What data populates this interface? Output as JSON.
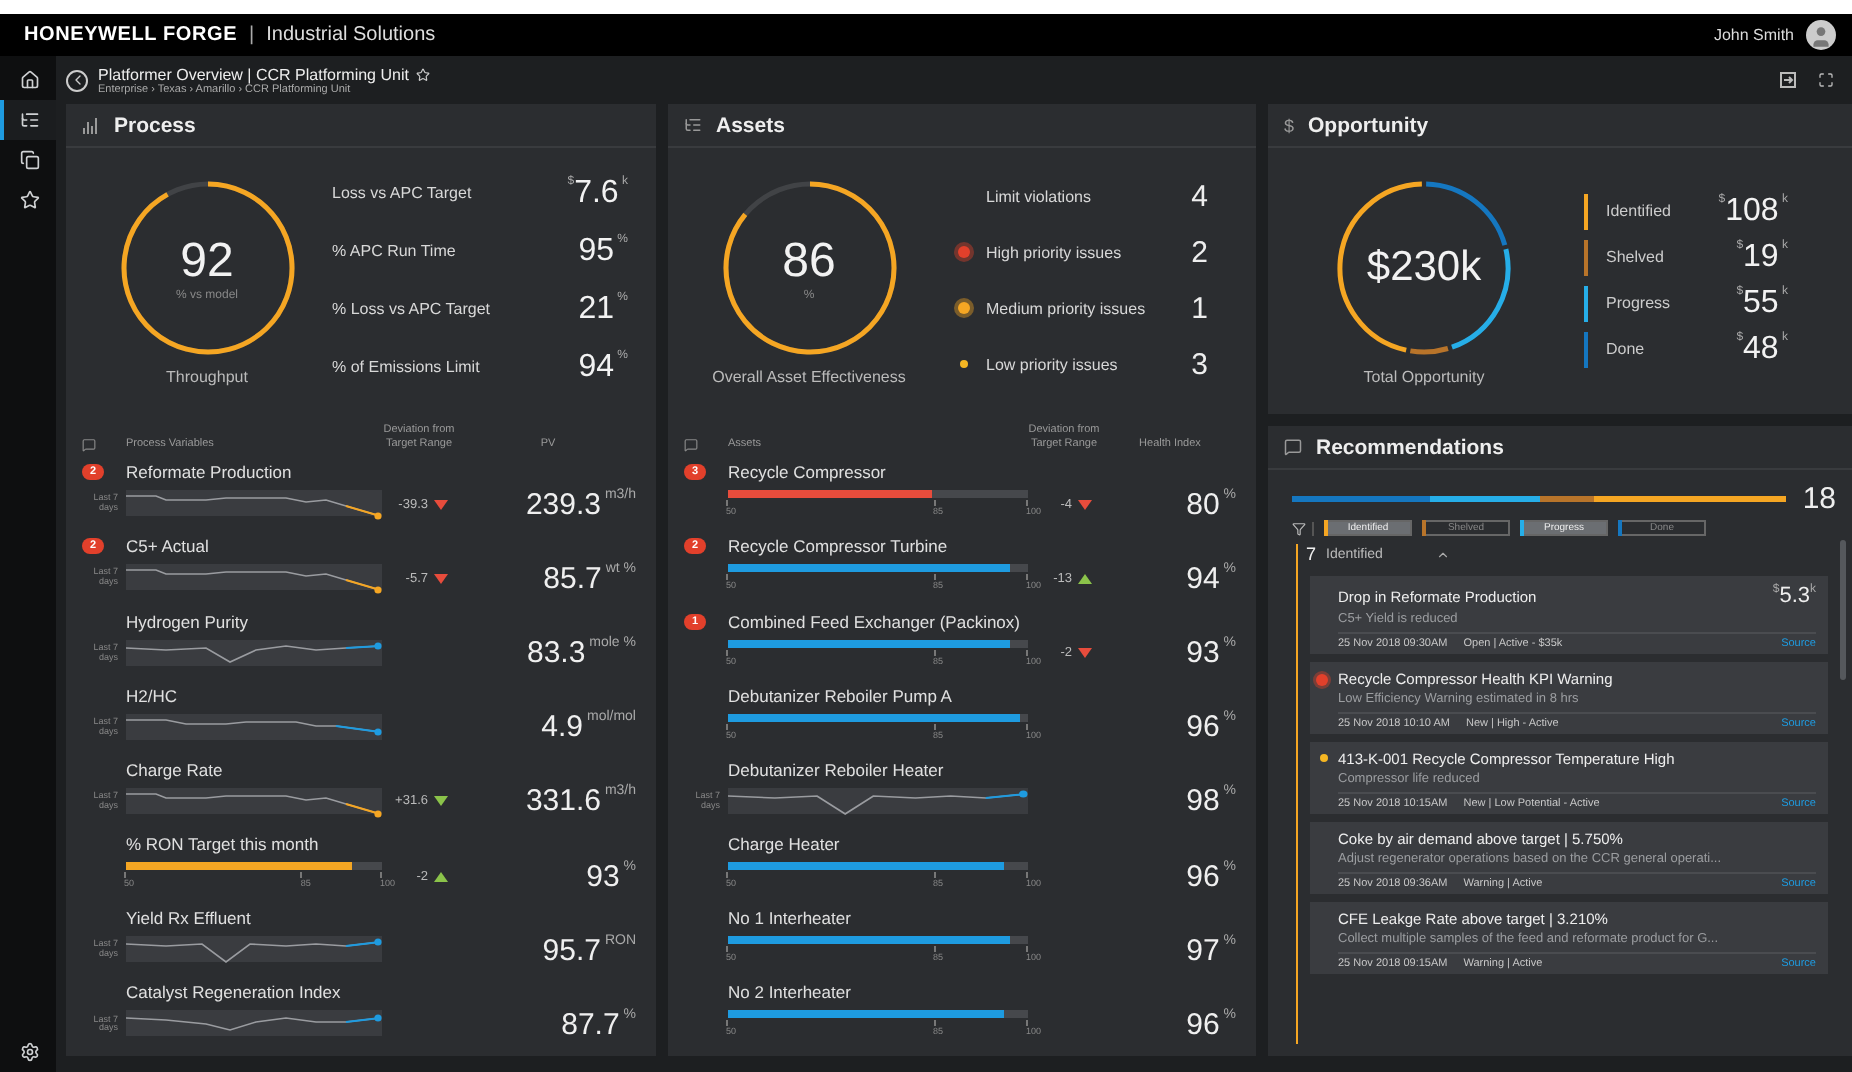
{
  "header": {
    "brand": "HONEYWELL FORGE",
    "separator": "|",
    "product": "Industrial Solutions",
    "user": "John Smith"
  },
  "sidebar": {
    "items": [
      {
        "selected": false
      },
      {
        "selected": true
      },
      {
        "selected": false
      },
      {
        "selected": false
      }
    ]
  },
  "breadcrumb": {
    "title": "Platformer Overview | CCR Platforming Unit",
    "path": "Enterprise › Texas › Amarillo › CCR Platforming Unit"
  },
  "process": {
    "title": "Process",
    "gauge": {
      "value": "92",
      "unit": "% vs model",
      "label": "Throughput"
    },
    "kpis": [
      {
        "label": "Loss vs APC Target",
        "prefix": "$",
        "value": "7.6",
        "suffix": "k"
      },
      {
        "label": "% APC Run Time",
        "value": "95",
        "suffix": "%"
      },
      {
        "label": "% Loss vs APC Target",
        "value": "21",
        "suffix": "%"
      },
      {
        "label": "% of Emissions Limit",
        "value": "94",
        "suffix": "%"
      }
    ],
    "columns": [
      "Process Variables",
      "Deviation from Target Range",
      "PV"
    ],
    "rows": [
      {
        "badge": "2",
        "name": "Reformate Production",
        "kind": "trend",
        "trend_label": "Last 7 days",
        "color": "#f5a623",
        "deviation": {
          "text": "-39.3",
          "up": false,
          "color": "#e74c3c"
        },
        "value": "239.3",
        "unit": "m3/h"
      },
      {
        "badge": "2",
        "name": "C5+ Actual",
        "kind": "trend",
        "trend_label": "Last 7 days",
        "color": "#f5a623",
        "deviation": {
          "text": "-5.7",
          "up": false,
          "color": "#e74c3c"
        },
        "value": "85.7",
        "unit": "wt %"
      },
      {
        "name": "Hydrogen Purity",
        "kind": "trend",
        "trend_label": "Last 7 days",
        "color": "#1e9be0",
        "value": "83.3",
        "unit": "mole %"
      },
      {
        "name": "H2/HC",
        "kind": "trend",
        "trend_label": "Last 7 days",
        "color": "#1e9be0",
        "value": "4.9",
        "unit": "mol/mol"
      },
      {
        "name": "Charge Rate",
        "kind": "trend",
        "trend_label": "Last 7 days",
        "color": "#f5a623",
        "deviation": {
          "text": "+31.6",
          "up": false,
          "color": "#8bc34a"
        },
        "value": "331.6",
        "unit": "m3/h"
      },
      {
        "name": "% RON Target this month",
        "kind": "bar",
        "level": 0.88,
        "color": "#f5a623",
        "scale": [
          "50",
          "85",
          "100"
        ],
        "deviation": {
          "text": "-2",
          "up": true,
          "color": "#8bc34a"
        },
        "value": "93",
        "unit": "%"
      },
      {
        "name": "Yield Rx Effluent",
        "kind": "trend",
        "trend_label": "Last 7 days",
        "color": "#1e9be0",
        "value": "95.7",
        "unit": "RON"
      },
      {
        "name": "Catalyst Regeneration Index",
        "kind": "trend",
        "trend_label": "Last 7 days",
        "color": "#1e9be0",
        "value": "87.7",
        "unit": "%"
      }
    ]
  },
  "assets": {
    "title": "Assets",
    "gauge": {
      "value": "86",
      "unit": "%",
      "label": "Overall Asset Effectiveness"
    },
    "issues": [
      {
        "label": "Limit violations",
        "count": "4",
        "kind": "plain"
      },
      {
        "label": "High priority issues",
        "count": "2",
        "kind": "high"
      },
      {
        "label": "Medium priority issues",
        "count": "1",
        "kind": "medium"
      },
      {
        "label": "Low priority issues",
        "count": "3",
        "kind": "low"
      }
    ],
    "columns": [
      "Assets",
      "Deviation from Target Range",
      "Health Index"
    ],
    "rows": [
      {
        "badge": "3",
        "name": "Recycle Compressor",
        "kind": "bar",
        "level": 0.68,
        "color": "#e74c3c",
        "scale": [
          "50",
          "85",
          "100"
        ],
        "deviation": {
          "text": "-4",
          "up": false,
          "color": "#e74c3c"
        },
        "value": "80",
        "unit": "%"
      },
      {
        "badge": "2",
        "name": "Recycle Compressor Turbine",
        "kind": "bar",
        "level": 0.94,
        "color": "#1e9be0",
        "scale": [
          "50",
          "85",
          "100"
        ],
        "deviation": {
          "text": "-13",
          "up": true,
          "color": "#8bc34a"
        },
        "value": "94",
        "unit": "%"
      },
      {
        "badge": "1",
        "name": "Combined Feed Exchanger (Packinox)",
        "kind": "bar",
        "level": 0.94,
        "color": "#1e9be0",
        "scale": [
          "50",
          "85",
          "100"
        ],
        "deviation": {
          "text": "-2",
          "up": false,
          "color": "#e74c3c"
        },
        "value": "93",
        "unit": "%"
      },
      {
        "name": "Debutanizer Reboiler Pump A",
        "kind": "bar",
        "level": 0.97,
        "color": "#1e9be0",
        "scale": [
          "50",
          "85",
          "100"
        ],
        "value": "96",
        "unit": "%"
      },
      {
        "name": "Debutanizer Reboiler Heater",
        "kind": "trend",
        "trend_label": "Last 7 days",
        "color": "#1e9be0",
        "value": "98",
        "unit": "%"
      },
      {
        "name": "Charge Heater",
        "kind": "bar",
        "level": 0.92,
        "color": "#1e9be0",
        "scale": [
          "50",
          "85",
          "100"
        ],
        "value": "96",
        "unit": "%"
      },
      {
        "name": "No 1 Interheater",
        "kind": "bar",
        "level": 0.94,
        "color": "#1e9be0",
        "scale": [
          "50",
          "85",
          "100"
        ],
        "value": "97",
        "unit": "%"
      },
      {
        "name": "No 2 Interheater",
        "kind": "bar",
        "level": 0.92,
        "color": "#1e9be0",
        "scale": [
          "50",
          "85",
          "100"
        ],
        "value": "96",
        "unit": "%"
      }
    ]
  },
  "opportunity": {
    "icon_text": "$",
    "title": "Opportunity",
    "gauge": {
      "value": "$230k",
      "label": "Total Opportunity"
    },
    "stats": [
      {
        "label": "Identified",
        "color": "#f5a623",
        "prefix": "$",
        "value": "108",
        "suffix": "k"
      },
      {
        "label": "Shelved",
        "color": "#b8742a",
        "prefix": "$",
        "value": "19",
        "suffix": "k"
      },
      {
        "label": "Progress",
        "color": "#26aee8",
        "prefix": "$",
        "value": "55",
        "suffix": "k"
      },
      {
        "label": "Done",
        "color": "#1577c0",
        "prefix": "$",
        "value": "48",
        "suffix": "k"
      }
    ]
  },
  "recommendations": {
    "title": "Recommendations",
    "count": "18",
    "bar": [
      {
        "color": "#1577c0"
      },
      {
        "color": "#26aee8"
      },
      {
        "color": "#b8742a"
      },
      {
        "color": "#f5a623"
      }
    ],
    "filters": [
      {
        "label": "Identified",
        "color": "#f5a623",
        "selected": true
      },
      {
        "label": "Shelved",
        "color": "#b8742a",
        "selected": false
      },
      {
        "label": "Progress",
        "color": "#26aee8",
        "selected": true
      },
      {
        "label": "Done",
        "color": "#1577c0",
        "selected": false
      }
    ],
    "group": {
      "count": "7",
      "label": "Identified",
      "expanded": true
    },
    "cards": [
      {
        "title": "Drop in Reformate Production",
        "kind": "plain",
        "amount": {
          "prefix": "$",
          "value": "5.3",
          "suffix": "k"
        },
        "subtitle": "C5+ Yield is reduced",
        "date": "25 Nov 2018 09:30AM",
        "status": "Open | Active - $35k",
        "link": "Source"
      },
      {
        "title": "Recycle Compressor Health KPI Warning",
        "kind": "high",
        "subtitle": "Low Efficiency Warning estimated in 8 hrs",
        "date": "25 Nov 2018 10:10 AM",
        "status": "New | High - Active",
        "link": "Source"
      },
      {
        "title": "413-K-001 Recycle Compressor Temperature High",
        "kind": "low",
        "subtitle": "Compressor life reduced",
        "date": "25 Nov 2018 10:15AM",
        "status": "New | Low Potential - Active",
        "link": "Source"
      },
      {
        "title": "Coke by air demand above target | 5.750%",
        "kind": "plain",
        "subtitle": "Adjust regenerator operations based on the CCR general operati...",
        "date": "25 Nov 2018 09:36AM",
        "status": "Warning | Active",
        "link": "Source"
      },
      {
        "title": "CFE Leakge Rate above target | 3.210%",
        "kind": "plain",
        "subtitle": "Collect multiple samples of the feed and reformate product for G...",
        "date": "25 Nov 2018 09:15AM",
        "status": "Warning | Active",
        "link": "Source"
      }
    ]
  }
}
